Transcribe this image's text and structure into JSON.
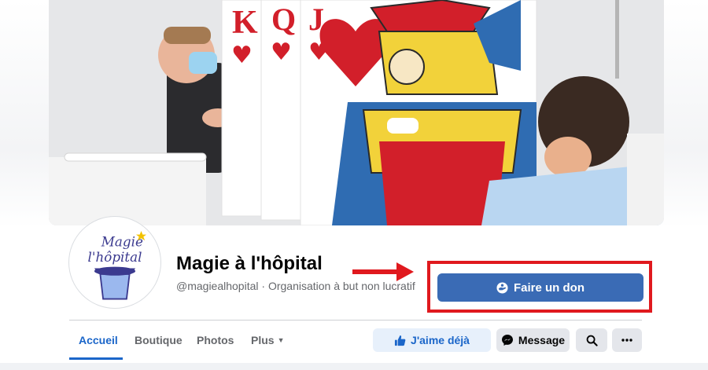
{
  "page": {
    "name": "Magie à l'hôpital",
    "handle": "@magiealhopital",
    "separator": " · ",
    "category": "Organisation à but non lucratif"
  },
  "cover": {
    "cards": [
      {
        "rank": "K",
        "suit": "♥"
      },
      {
        "rank": "Q",
        "suit": "♥"
      },
      {
        "rank": "J",
        "suit": "♥"
      }
    ]
  },
  "avatar": {
    "logo_line1": "Magie",
    "logo_line2": "l'hôpital"
  },
  "donate": {
    "label": "Faire un don",
    "icon": "donate-hand-icon"
  },
  "tabs": [
    {
      "label": "Accueil",
      "active": true
    },
    {
      "label": "Boutique",
      "active": false
    },
    {
      "label": "Photos",
      "active": false
    },
    {
      "label": "Plus",
      "active": false,
      "caret": "▼"
    }
  ],
  "actions": {
    "like_label": "J'aime déjà",
    "message_label": "Message",
    "like_icon": "thumbs-up-icon",
    "message_icon": "messenger-icon",
    "search_icon": "search-icon",
    "more_icon": "more-icon"
  },
  "colors": {
    "accent": "#1b66c9",
    "donate_button": "#3a6bb5",
    "highlight_annotation": "#e0191e"
  }
}
